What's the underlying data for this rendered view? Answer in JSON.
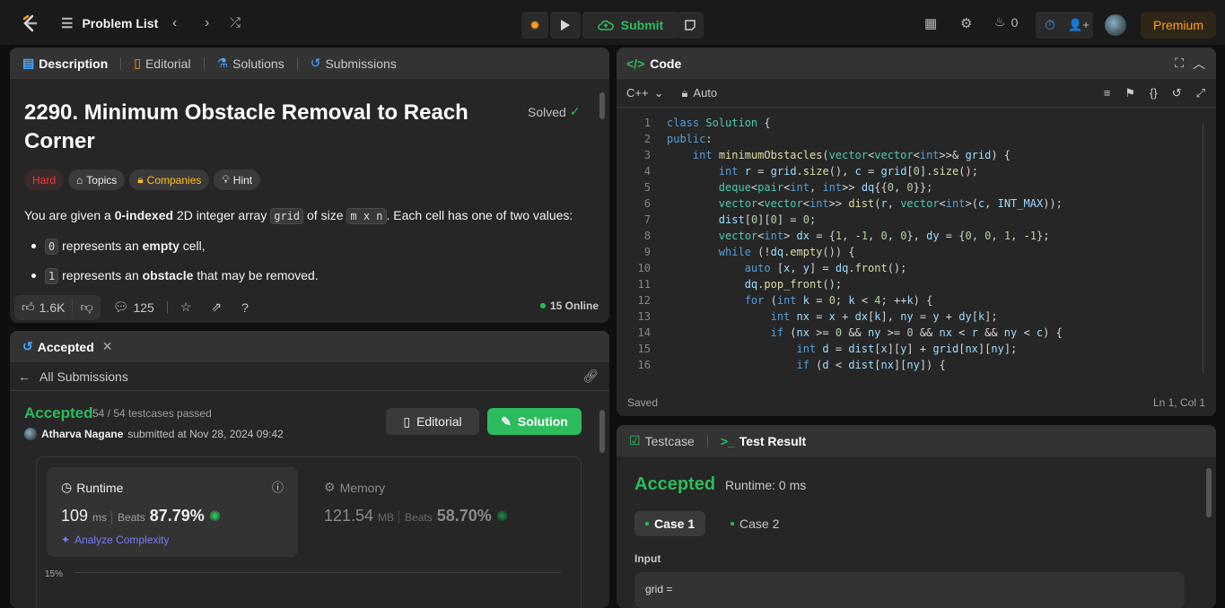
{
  "topbar": {
    "problem_list": "Problem List",
    "submit": "Submit",
    "streak_count": "0",
    "premium": "Premium"
  },
  "description": {
    "tabs": [
      "Description",
      "Editorial",
      "Solutions",
      "Submissions"
    ],
    "title": "2290. Minimum Obstacle Removal to Reach Corner",
    "status": "Solved",
    "chips": [
      "Hard",
      "Topics",
      "Companies",
      "Hint"
    ],
    "intro_1": "You are given a ",
    "intro_bold": "0-indexed",
    "intro_2": " 2D integer array ",
    "intro_code1": "grid",
    "intro_3": " of size ",
    "intro_code2": "m x n",
    "intro_4": ". Each cell has one of two values:",
    "bullets": [
      {
        "code": "0",
        "pre": "represents an ",
        "bold": "empty",
        "post": " cell,"
      },
      {
        "code": "1",
        "pre": "represents an ",
        "bold": "obstacle",
        "post": " that may be removed."
      }
    ],
    "likes": "1.6K",
    "comments": "125",
    "online": "15 Online"
  },
  "submission": {
    "tab": "Accepted",
    "all_submissions": "All Submissions",
    "status": "Accepted",
    "testcases": "54 / 54 testcases passed",
    "user": "Atharva Nagane",
    "submitted_at": "submitted at Nov 28, 2024 09:42",
    "editorial_btn": "Editorial",
    "solution_btn": "Solution",
    "runtime_label": "Runtime",
    "runtime_value": "109",
    "runtime_unit": "ms",
    "runtime_beats_label": "Beats",
    "runtime_beats": "87.79%",
    "analyze": "Analyze Complexity",
    "memory_label": "Memory",
    "memory_value": "121.54",
    "memory_unit": "MB",
    "memory_beats_label": "Beats",
    "memory_beats": "58.70%",
    "chart_tick": "15%"
  },
  "code": {
    "title": "Code",
    "language": "C++",
    "mode": "Auto",
    "footer_left": "Saved",
    "footer_right": "Ln 1, Col 1",
    "lines": [
      "class Solution {",
      "public:",
      "    int minimumObstacles(vector<vector<int>>& grid) {",
      "        int r = grid.size(), c = grid[0].size();",
      "        deque<pair<int, int>> dq{{0, 0}};",
      "        vector<vector<int>> dist(r, vector<int>(c, INT_MAX));",
      "        dist[0][0] = 0;",
      "        vector<int> dx = {1, -1, 0, 0}, dy = {0, 0, 1, -1};",
      "        while (!dq.empty()) {",
      "            auto [x, y] = dq.front();",
      "            dq.pop_front();",
      "            for (int k = 0; k < 4; ++k) {",
      "                int nx = x + dx[k], ny = y + dy[k];",
      "                if (nx >= 0 && ny >= 0 && nx < r && ny < c) {",
      "                    int d = dist[x][y] + grid[nx][ny];",
      "                    if (d < dist[nx][ny]) {"
    ]
  },
  "test": {
    "tabs": [
      "Testcase",
      "Test Result"
    ],
    "status": "Accepted",
    "runtime": "Runtime: 0 ms",
    "cases": [
      "Case 1",
      "Case 2"
    ],
    "input_label": "Input",
    "input_value": "grid ="
  }
}
